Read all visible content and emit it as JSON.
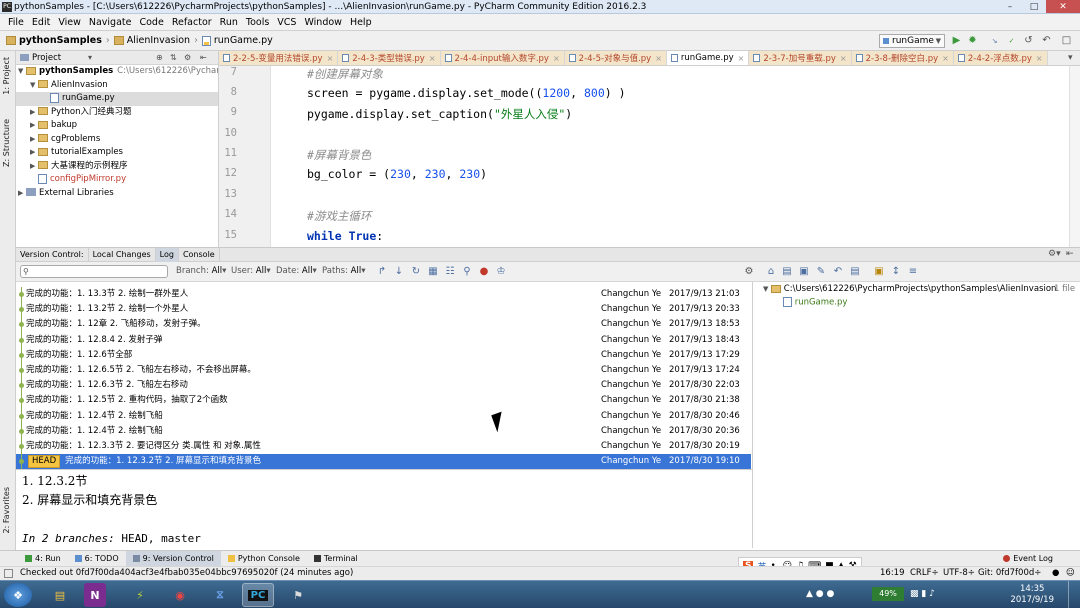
{
  "window": {
    "title": "pythonSamples - [C:\\Users\\612226\\PycharmProjects\\pythonSamples] - ...\\AlienInvasion\\runGame.py - PyCharm Community Edition 2016.2.3"
  },
  "menu": [
    "File",
    "Edit",
    "View",
    "Navigate",
    "Code",
    "Refactor",
    "Run",
    "Tools",
    "VCS",
    "Window",
    "Help"
  ],
  "nav": {
    "crumbs": [
      "pythonSamples",
      "AlienInvasion",
      "runGame.py"
    ],
    "run_config": "runGame"
  },
  "project_panel": {
    "header": "Project",
    "items": [
      {
        "label": "pythonSamples",
        "path": "C:\\Users\\612226\\Pycharm",
        "kind": "folder",
        "level": 0,
        "open": true
      },
      {
        "label": "AlienInvasion",
        "kind": "folder",
        "level": 1,
        "open": true
      },
      {
        "label": "runGame.py",
        "kind": "py",
        "level": 2,
        "selected": true
      },
      {
        "label": "Python入门经典习题",
        "kind": "folder",
        "level": 1
      },
      {
        "label": "bakup",
        "kind": "folder",
        "level": 1
      },
      {
        "label": "cgProblems",
        "kind": "folder",
        "level": 1
      },
      {
        "label": "tutorialExamples",
        "kind": "folder",
        "level": 1
      },
      {
        "label": "大基课程的示例程序",
        "kind": "folder",
        "level": 1
      },
      {
        "label": "configPipMirror.py",
        "kind": "py",
        "level": 1,
        "red": true
      },
      {
        "label": "External Libraries",
        "kind": "lib",
        "level": 0
      }
    ]
  },
  "editor_tabs": [
    {
      "label": "2-2-5-变量用法错误.py"
    },
    {
      "label": "2-4-3-类型错误.py"
    },
    {
      "label": "2-4-4-input输入数字.py"
    },
    {
      "label": "2-4-5-对象与值.py"
    },
    {
      "label": "runGame.py",
      "active": true
    },
    {
      "label": "2-3-7-加号重载.py"
    },
    {
      "label": "2-3-8-删除空白.py"
    },
    {
      "label": "2-4-2-浮点数.py"
    }
  ],
  "editor": {
    "lines": [
      {
        "n": "7",
        "code": "#创建屏幕对象"
      },
      {
        "n": "8",
        "code": "screen = pygame.display.set_mode((1200, 800) )"
      },
      {
        "n": "9",
        "code": "pygame.display.set_caption(\"外星人入侵\")"
      },
      {
        "n": "10",
        "code": ""
      },
      {
        "n": "11",
        "code": "#屏幕背景色"
      },
      {
        "n": "12",
        "code": "bg_color = (230, 230, 230)"
      },
      {
        "n": "13",
        "code": ""
      },
      {
        "n": "14",
        "code": "#游戏主循环"
      },
      {
        "n": "15",
        "code": "while True:"
      }
    ]
  },
  "vc_tabs": [
    "Version Control:",
    "Local Changes",
    "Log",
    "Console"
  ],
  "log_toolbar": {
    "search_placeholder": "",
    "filters": [
      {
        "label": "Branch:",
        "value": "All"
      },
      {
        "label": "User:",
        "value": "All"
      },
      {
        "label": "Date:",
        "value": "All"
      },
      {
        "label": "Paths:",
        "value": "All"
      }
    ]
  },
  "log": {
    "rows": [
      {
        "msg": "完成的功能：1. 13.3节 2. 绘制一群外星人",
        "author": "Changchun Ye",
        "date": "2017/9/13 21:03"
      },
      {
        "msg": "完成的功能：1. 13.2节 2. 绘制一个外星人",
        "author": "Changchun Ye",
        "date": "2017/9/13 20:33"
      },
      {
        "msg": "完成的功能：1. 12章 2. 飞船移动，发射子弹。",
        "author": "Changchun Ye",
        "date": "2017/9/13 18:53"
      },
      {
        "msg": "完成的功能：1. 12.8.4 2. 发射子弹",
        "author": "Changchun Ye",
        "date": "2017/9/13 18:43"
      },
      {
        "msg": "完成的功能：1. 12.6节全部",
        "author": "Changchun Ye",
        "date": "2017/9/13 17:29"
      },
      {
        "msg": "完成的功能：1. 12.6.5节 2. 飞船左右移动，不会移出屏幕。",
        "author": "Changchun Ye",
        "date": "2017/9/13 17:24"
      },
      {
        "msg": "完成的功能：1. 12.6.3节 2. 飞船左右移动",
        "author": "Changchun Ye",
        "date": "2017/8/30 22:03"
      },
      {
        "msg": "完成的功能：1. 12.5节 2. 重构代码，抽取了2个函数",
        "author": "Changchun Ye",
        "date": "2017/8/30 21:38"
      },
      {
        "msg": "完成的功能：1. 12.4节 2. 绘制飞船",
        "author": "Changchun Ye",
        "date": "2017/8/30 20:46"
      },
      {
        "msg": "完成的功能：1. 12.4节 2. 绘制飞船",
        "author": "Changchun Ye",
        "date": "2017/8/30 20:36"
      },
      {
        "msg": "完成的功能：1. 12.3.3节 2. 要记得区分 类.属性 和 对象.属性",
        "author": "Changchun Ye",
        "date": "2017/8/30 20:19"
      },
      {
        "msg": "完成的功能：1. 12.3.2节 2. 屏幕显示和填充背景色",
        "author": "Changchun Ye",
        "date": "2017/8/30 19:10",
        "head": "HEAD",
        "selected": true
      }
    ]
  },
  "details": {
    "line1": "1.  12.3.2节",
    "line2": "2.  屏幕显示和填充背景色",
    "branches_label": "In 2 branches:",
    "branches_value": "HEAD, master"
  },
  "changes": {
    "path": "C:\\Users\\612226\\PycharmProjects\\pythonSamples\\AlienInvasion",
    "count": "1 file",
    "file": "runGame.py"
  },
  "tool_tabs": [
    {
      "label": "4: Run"
    },
    {
      "label": "6: TODO"
    },
    {
      "label": "9: Version Control",
      "active": true
    },
    {
      "label": "Python Console"
    },
    {
      "label": "Terminal"
    }
  ],
  "event_log": "Event Log",
  "status": {
    "message": "Checked out 0fd7f00da404acf3e4fbab035e04bbc97695020f (24 minutes ago)",
    "position": "16:19",
    "line_sep": "CRLF÷",
    "encoding": "UTF-8÷",
    "git": "Git: 0fd7f00d÷"
  },
  "left_vtabs": [
    "1: Project",
    "Z: Structure",
    "2: Favorites"
  ],
  "ime": {
    "lang": "英"
  },
  "taskbar": {
    "battery": "49%",
    "time": "14:35",
    "date": "2017/9/19"
  }
}
